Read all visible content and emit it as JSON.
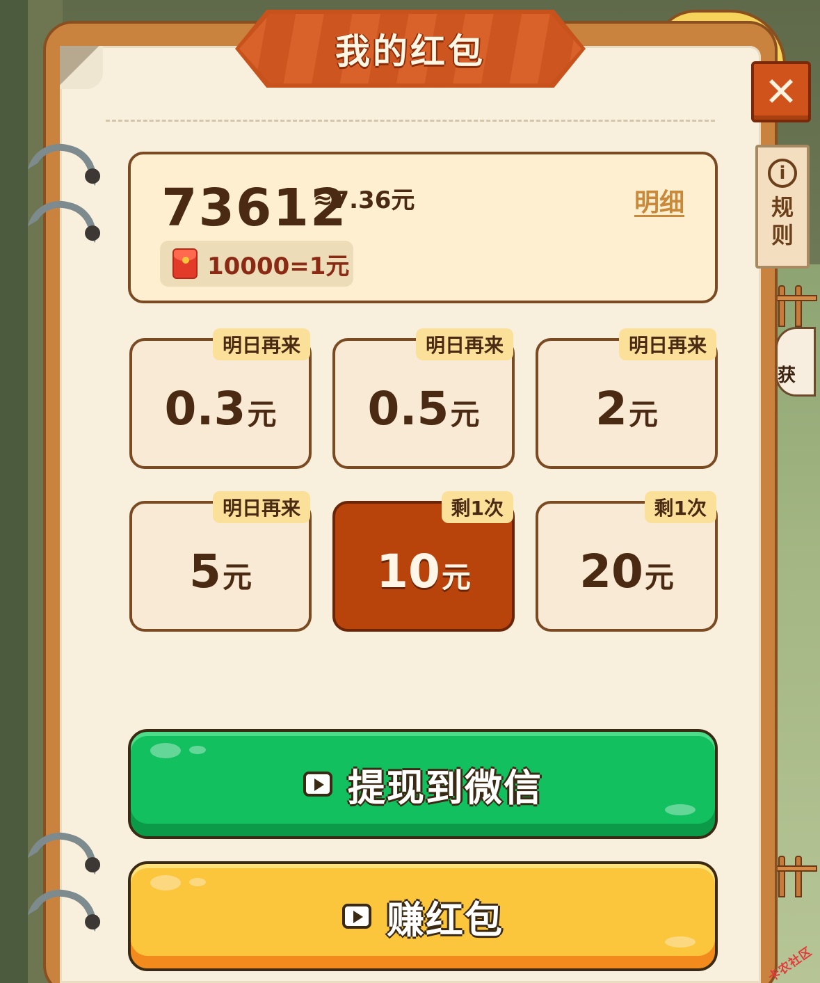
{
  "title": "我的红包",
  "rules_label": "规则",
  "balance": {
    "coins": "73612",
    "approx": "≈7.36元",
    "detail_link": "明细",
    "rate": "10000=1元"
  },
  "options": [
    {
      "value": "0.3",
      "unit": "元",
      "tag": "明日再来",
      "selected": false
    },
    {
      "value": "0.5",
      "unit": "元",
      "tag": "明日再来",
      "selected": false
    },
    {
      "value": "2",
      "unit": "元",
      "tag": "明日再来",
      "selected": false
    },
    {
      "value": "5",
      "unit": "元",
      "tag": "明日再来",
      "selected": false
    },
    {
      "value": "10",
      "unit": "元",
      "tag": "剩1次",
      "selected": true
    },
    {
      "value": "20",
      "unit": "元",
      "tag": "剩1次",
      "selected": false
    }
  ],
  "buttons": {
    "withdraw": "提现到微信",
    "earn": "赚红包"
  },
  "background": {
    "bubble_text": "获",
    "watermark": "卡农社区"
  },
  "colors": {
    "banner": "#c8521c",
    "selected_option": "#b8440c",
    "withdraw_button": "#12c060",
    "earn_button": "#fbc53c"
  }
}
